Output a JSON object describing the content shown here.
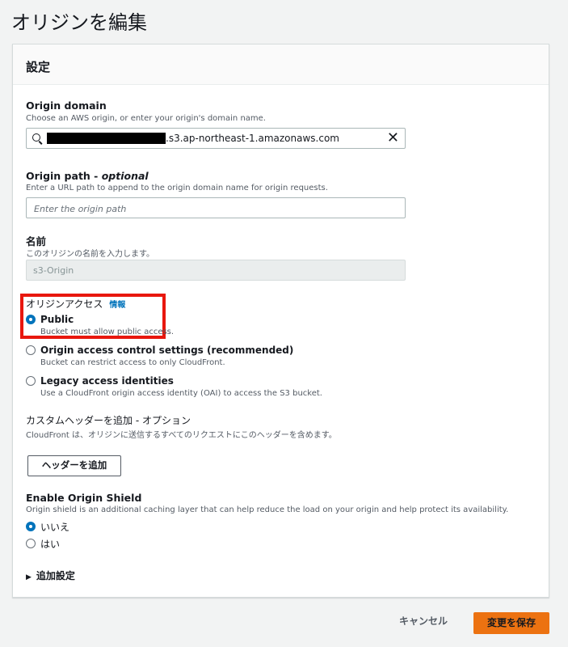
{
  "page": {
    "title": "オリジンを編集"
  },
  "panel": {
    "title": "設定"
  },
  "origin_domain": {
    "label": "Origin domain",
    "description": "Choose an AWS origin, or enter your origin's domain name.",
    "value_visible": ".s3.ap-northeast-1.amazonaws.com"
  },
  "origin_path": {
    "label": "Origin path - ",
    "optional": "optional",
    "description": "Enter a URL path to append to the origin domain name for origin requests.",
    "placeholder": "Enter the origin path"
  },
  "origin_name": {
    "label": "名前",
    "description": "このオリジンの名前を入力します。",
    "value": "s3-Origin"
  },
  "origin_access": {
    "label": "オリジンアクセス",
    "info": "情報",
    "options": [
      {
        "label": "Public",
        "description": "Bucket must allow public access.",
        "selected": true
      },
      {
        "label": "Origin access control settings (recommended)",
        "description": "Bucket can restrict access to only CloudFront.",
        "selected": false
      },
      {
        "label": "Legacy access identities",
        "description": "Use a CloudFront origin access identity (OAI) to access the S3 bucket.",
        "selected": false
      }
    ]
  },
  "custom_headers": {
    "label": "カスタムヘッダーを追加 - オプション",
    "description": "CloudFront は、オリジンに送信するすべてのリクエストにこのヘッダーを含めます。",
    "button": "ヘッダーを追加"
  },
  "origin_shield": {
    "label": "Enable Origin Shield",
    "description": "Origin shield is an additional caching layer that can help reduce the load on your origin and help protect its availability.",
    "options": [
      {
        "label": "いいえ",
        "selected": true
      },
      {
        "label": "はい",
        "selected": false
      }
    ]
  },
  "additional_settings": {
    "label": "追加設定"
  },
  "footer": {
    "cancel": "キャンセル",
    "save": "変更を保存"
  },
  "colors": {
    "accent": "#0073bb",
    "primary_button": "#ec7211",
    "highlight": "#e8170e"
  },
  "icons": {
    "search": "search-icon",
    "clear": "close-icon",
    "expand": "caret-right-icon"
  }
}
